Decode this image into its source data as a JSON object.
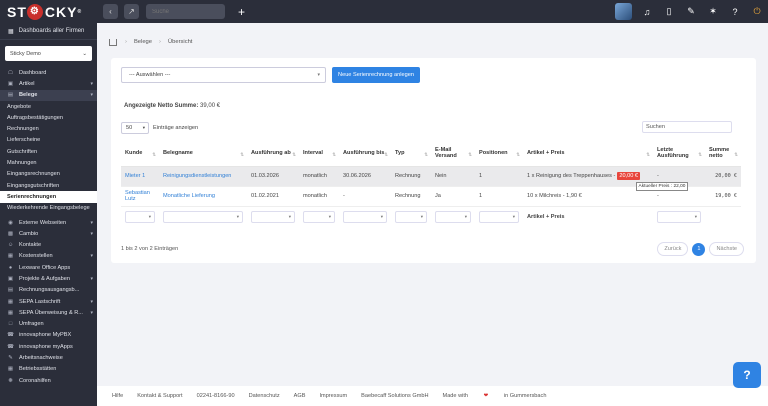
{
  "app": {
    "logo_text": "ST",
    "logo_text2": "CKY",
    "logo_tm": "®"
  },
  "topbar": {
    "search_placeholder": "Suche",
    "plus": "+"
  },
  "sidebar": {
    "dashboards_label": "Dashboards aller Firmen",
    "company": "Sticky Demo",
    "items": [
      {
        "label": "Dashboard"
      },
      {
        "label": "Artikel"
      },
      {
        "label": "Belege"
      }
    ],
    "belege_sub": [
      "Angebote",
      "Auftragsbestätigungen",
      "Rechnungen",
      "Lieferscheine",
      "Gutschriften",
      "Mahnungen",
      "Eingangsrechnungen",
      "Eingangsgutschriften"
    ],
    "serienrechnungen": "Serienrechnungen",
    "wiederkehrend": "Wiederkehrende Eingangsbelege",
    "more_items": [
      {
        "label": "Externe Webseiten"
      },
      {
        "label": "Cambio"
      },
      {
        "label": "Kontakte"
      },
      {
        "label": "Kostenstellen"
      },
      {
        "label": "Lexware Office Apps"
      },
      {
        "label": "Projekte & Aufgaben"
      },
      {
        "label": "Rechnungsausgangsb..."
      },
      {
        "label": "SEPA Lastschrift"
      },
      {
        "label": "SEPA Überweisung & R..."
      },
      {
        "label": "Umfragen"
      },
      {
        "label": "innovaphone MyPBX"
      },
      {
        "label": "innovaphone myApps"
      },
      {
        "label": "Arbeitsnachweise"
      },
      {
        "label": "Betriebsstätten"
      },
      {
        "label": "Coronahilfen"
      }
    ]
  },
  "breadcrumb": {
    "items": [
      "Belege",
      "Übersicht"
    ]
  },
  "main": {
    "select_value": "--- Auswählen ---",
    "new_button": "Neue Serienrechnung anlegen",
    "netto_label": "Angezeigte Netto Summe:",
    "netto_value": "39,00 €",
    "entries_value": "50",
    "entries_label": "Einträge anzeigen",
    "search_label": "Suchen",
    "columns": [
      "Kunde",
      "Belegname",
      "Ausführung ab",
      "Interval",
      "Ausführung bis",
      "Typ",
      "E-Mail Versand",
      "Positionen",
      "Artikel + Preis",
      "Letzte Ausführung",
      "Summe netto"
    ],
    "rows": [
      {
        "kunde": "Mieter 1",
        "belegname": "Reinigungsdienstleistungen",
        "ab": "01.03.2026",
        "interval": "monatlich",
        "bis": "30.06.2026",
        "typ": "Rechnung",
        "email": "Nein",
        "positionen": "1",
        "artikel": "1 x Reinigung des Treppenhauses -",
        "preis": "20,00 €",
        "letzte": "-",
        "summe": "20,00 €"
      },
      {
        "kunde": "Sebastian Lutz",
        "belegname": "Monatliche Lieferung",
        "ab": "01.02.2021",
        "interval": "monatlich",
        "bis": "-",
        "typ": "Rechnung",
        "email": "Ja",
        "positionen": "1",
        "artikel": "10 x Milchreis - 1,90 €",
        "preis": "",
        "letzte": "-",
        "summe": "19,00 €"
      }
    ],
    "filter_artikel": "Artikel + Preis",
    "tooltip": "Aktueller Preis : 22,00",
    "info_count": "1 bis 2 von 2 Einträgen",
    "pager_prev": "Zurück",
    "pager_current": "1",
    "pager_next": "Nächste"
  },
  "footer": {
    "links": [
      "Hilfe",
      "Kontakt & Support",
      "02241-8166-90",
      "Datenschutz",
      "AGB",
      "Impressum",
      "Baebecaff Solutions GmbH"
    ],
    "made_with": "Made with",
    "heart": "❤",
    "in_city": "in Gummersbach"
  },
  "icons": [
    "gear-icon",
    "back-icon",
    "expand-icon",
    "bell-icon",
    "tablet-icon",
    "pen-icon",
    "settings-icon",
    "help-icon",
    "power-icon",
    "home-icon",
    "chat-icon"
  ],
  "colors": {
    "sidebar": "#2b2e3a",
    "primary": "#2f83e3",
    "danger": "#e8453c",
    "link": "#2f7fd6"
  }
}
